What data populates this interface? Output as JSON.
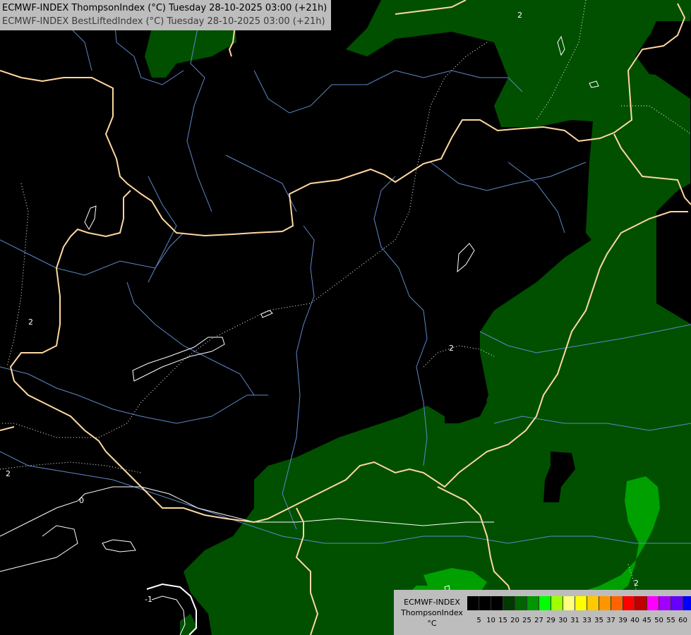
{
  "title_lines": [
    "ECMWF-INDEX ThompsonIndex (°C) Tuesday 28-10-2025 03:00 (+21h)",
    "ECMWF-INDEX BestLiftedIndex (°C) Tuesday 28-10-2025 03:00 (+21h)"
  ],
  "legend": {
    "line1": "ECMWF-INDEX",
    "line2": "ThompsonIndex",
    "line3": "°C",
    "labels": [
      "5",
      "10",
      "15",
      "20",
      "25",
      "27",
      "29",
      "30",
      "31",
      "33",
      "35",
      "37",
      "39",
      "40",
      "45",
      "50",
      "55",
      "60"
    ],
    "colors": [
      "#000000",
      "#000000",
      "#000000",
      "#003a00",
      "#006400",
      "#009600",
      "#00ff00",
      "#a0ff00",
      "#ffff80",
      "#ffff00",
      "#ffc800",
      "#ff9600",
      "#ff6400",
      "#ff0000",
      "#c00000",
      "#ff00ff",
      "#a000ff",
      "#6400ff",
      "#0000ff"
    ]
  },
  "contour_labels": [
    {
      "text": "2",
      "pos": "top-center"
    },
    {
      "text": "2",
      "pos": "left"
    },
    {
      "text": "2",
      "pos": "lower-left"
    },
    {
      "text": "2",
      "pos": "center"
    },
    {
      "text": "0",
      "pos": "lower-left"
    },
    {
      "text": "-1",
      "pos": "bottom-left"
    },
    {
      "text": "2",
      "pos": "bottom-right"
    }
  ],
  "colors": {
    "dark_green": "#005000",
    "mid_green": "#00a000",
    "border": "#ffd7a0",
    "river": "#5f87c8",
    "contour": "#ffffff",
    "legend_bg": "#bdbdbd"
  }
}
